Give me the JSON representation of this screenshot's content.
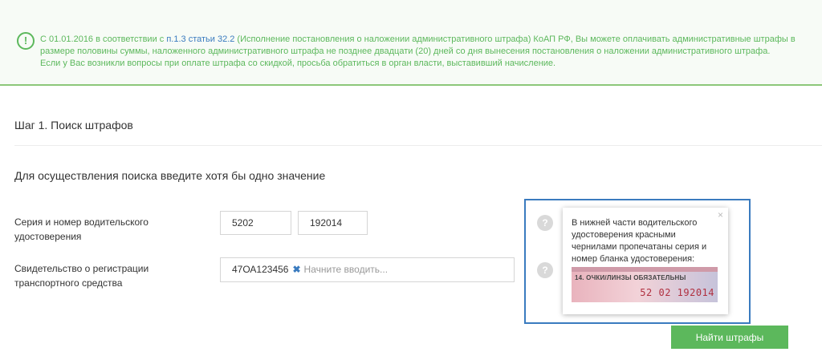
{
  "notice": {
    "icon": "exclamation-circle-icon",
    "line1_prefix": "С 01.01.2016 в соответствии с ",
    "link1": "п.1.3 статьи 32.2",
    "line1_suffix": " (Исполнение постановления о наложении административного штрафа) КоАП РФ, Вы можете оплачивать административные штрафы в размере половины суммы, наложенного административного штрафа не позднее двадцати (20) дней со дня вынесения постановления о наложении административного штрафа.",
    "line2": "Если у Вас возникли вопросы при оплате штрафа со скидкой, просьба обратиться в орган власти, выставивший начисление.",
    "text_color": "#5cb85c",
    "link_color": "#3a7bbf"
  },
  "step": {
    "title": "Шаг 1. Поиск штрафов"
  },
  "search": {
    "heading": "Для осуществления поиска введите хотя бы одно значение",
    "license": {
      "label": "Серия и номер водительского удостоверения",
      "series": "5202",
      "number": "192014"
    },
    "registration": {
      "label": "Свидетельство о регистрации транспортного средства",
      "tag": "47ОА123456",
      "remove_icon": "✖",
      "placeholder": "Начните вводить..."
    },
    "submit_label": "Найти штрафы"
  },
  "help": {
    "icon_glyph": "?",
    "tooltip_close": "×",
    "tooltip_text": "В нижней части водительского удостоверения красными чернилами пропечатаны серия и номер бланка удостоверения:",
    "image": {
      "field_text": "14. ОЧКИ/ЛИНЗЫ ОБЯЗАТЕЛЬНЫ",
      "number_text": "52 02 192014"
    }
  },
  "colors": {
    "accent_green": "#5cb85c",
    "accent_blue": "#3a7bbf"
  }
}
